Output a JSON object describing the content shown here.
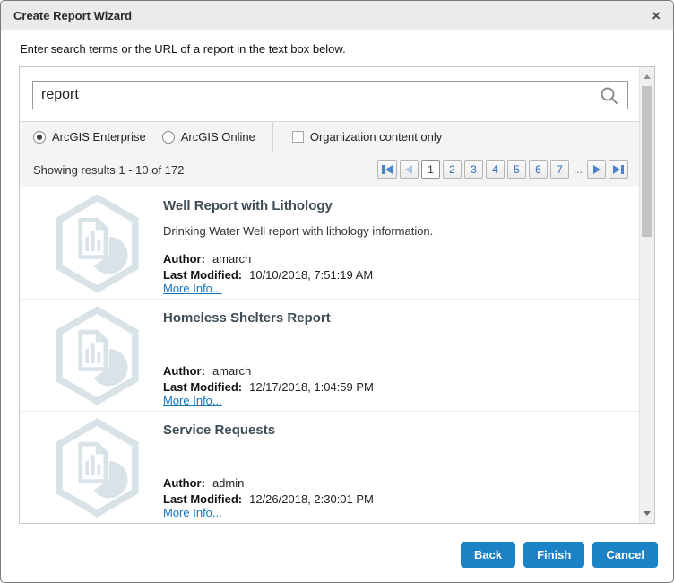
{
  "window": {
    "title": "Create Report Wizard",
    "close_glyph": "×"
  },
  "instruction": "Enter search terms or the URL of a report in the text box below.",
  "search": {
    "value": "report"
  },
  "filters": {
    "enterprise_label": "ArcGIS Enterprise",
    "online_label": "ArcGIS Online",
    "org_only_label": "Organization content only"
  },
  "results_header": {
    "summary": "Showing results 1 - 10 of 172",
    "pages": [
      "1",
      "2",
      "3",
      "4",
      "5",
      "6",
      "7"
    ],
    "ellipsis": "..."
  },
  "labels": {
    "author": "Author:",
    "modified": "Last Modified:",
    "more_info": "More Info..."
  },
  "results": [
    {
      "title": "Well Report with Lithology",
      "description": "Drinking Water Well report with lithology information.",
      "author": "amarch",
      "modified": "10/10/2018, 7:51:19 AM"
    },
    {
      "title": "Homeless Shelters Report",
      "description": "",
      "author": "amarch",
      "modified": "12/17/2018, 1:04:59 PM"
    },
    {
      "title": "Service Requests",
      "description": "",
      "author": "admin",
      "modified": "12/26/2018, 2:30:01 PM"
    }
  ],
  "footer": {
    "back": "Back",
    "finish": "Finish",
    "cancel": "Cancel"
  },
  "colors": {
    "accent_blue": "#1b82c6",
    "link_blue": "#1a75bb",
    "result_icon_tint": "#d9e3e7",
    "result_title_text": "#3e4c55"
  }
}
